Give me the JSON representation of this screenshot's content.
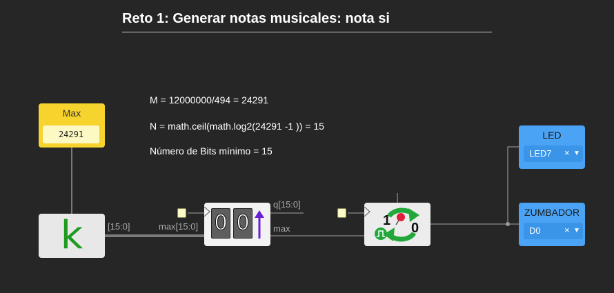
{
  "title": "Reto 1: Generar notas musicales: nota si",
  "notes": [
    "M = 12000000/494 = 24291",
    "N = math.ceil(math.log2(24291 -1 )) = 15",
    "Número de Bits mínimo = 15"
  ],
  "constant_block": {
    "title": "Max",
    "value": "24291"
  },
  "k_block": {
    "glyph": "k"
  },
  "counter_block": {
    "digits": [
      "0",
      "0"
    ]
  },
  "prescaler_block": {
    "left_label": "1",
    "right_label": "0"
  },
  "wire_labels": {
    "k_out": "[15:0]",
    "counter_max_in": "max[15:0]",
    "counter_q_out": "q[15:0]",
    "counter_max_out": "max"
  },
  "outputs": [
    {
      "title": "LED",
      "value": "LED7",
      "clear": "×",
      "arrow": "▼"
    },
    {
      "title": "ZUMBADOR",
      "value": "D0",
      "clear": "×",
      "arrow": "▼"
    }
  ],
  "colors": {
    "background": "#262626",
    "constant_yellow": "#f6d32d",
    "output_blue": "#4aa3f5",
    "k_green": "#1f9b1f",
    "arrow_purple": "#6a1fd6",
    "cycle_green": "#22a83a",
    "pin_red": "#e0203a"
  },
  "icons": [
    "up-arrow-icon",
    "cycle-arrows-icon",
    "pushpin-icon",
    "pulse-icon"
  ]
}
